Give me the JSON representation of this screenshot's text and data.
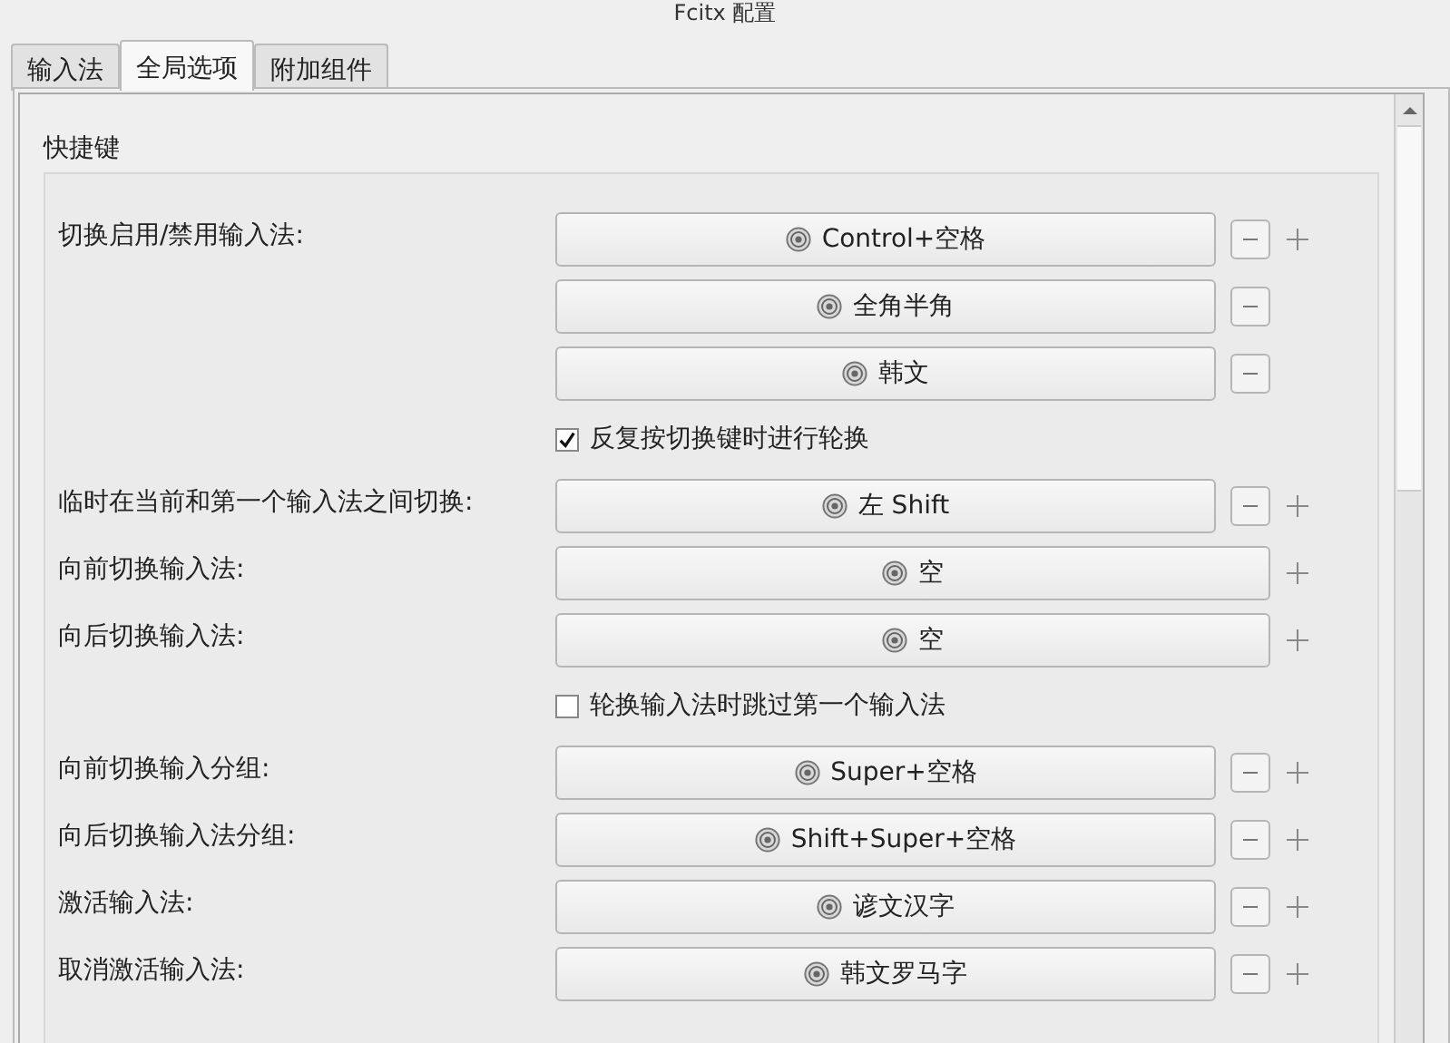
{
  "window": {
    "title": "Fcitx 配置"
  },
  "tabs": [
    {
      "label": "输入法",
      "selected": false
    },
    {
      "label": "全局选项",
      "selected": true
    },
    {
      "label": "附加组件",
      "selected": false
    }
  ],
  "section": {
    "title": "快捷键"
  },
  "rows": [
    {
      "kind": "hotkey",
      "label": "切换启用/禁用输入法:",
      "add": true,
      "keys": [
        {
          "label": "Control+空格",
          "removable": true
        },
        {
          "label": "全角半角",
          "removable": true
        },
        {
          "label": "韩文",
          "removable": true
        }
      ]
    },
    {
      "kind": "checkbox",
      "label": "反复按切换键时进行轮换",
      "checked": true
    },
    {
      "kind": "hotkey",
      "label": "临时在当前和第一个输入法之间切换:",
      "add": true,
      "keys": [
        {
          "label": "左 Shift",
          "removable": true
        }
      ]
    },
    {
      "kind": "hotkey",
      "label": "向前切换输入法:",
      "add": true,
      "keys": [
        {
          "label": "空",
          "removable": false
        }
      ]
    },
    {
      "kind": "hotkey",
      "label": "向后切换输入法:",
      "add": true,
      "keys": [
        {
          "label": "空",
          "removable": false
        }
      ]
    },
    {
      "kind": "checkbox",
      "label": "轮换输入法时跳过第一个输入法",
      "checked": false
    },
    {
      "kind": "hotkey",
      "label": "向前切换输入分组:",
      "add": true,
      "keys": [
        {
          "label": "Super+空格",
          "removable": true
        }
      ]
    },
    {
      "kind": "hotkey",
      "label": "向后切换输入法分组:",
      "add": true,
      "keys": [
        {
          "label": "Shift+Super+空格",
          "removable": true
        }
      ]
    },
    {
      "kind": "hotkey",
      "label": "激活输入法:",
      "add": true,
      "keys": [
        {
          "label": "谚文汉字",
          "removable": true
        }
      ]
    },
    {
      "kind": "hotkey",
      "label": "取消激活输入法:",
      "add": true,
      "keys": [
        {
          "label": "韩文罗马字",
          "removable": true
        }
      ]
    }
  ]
}
